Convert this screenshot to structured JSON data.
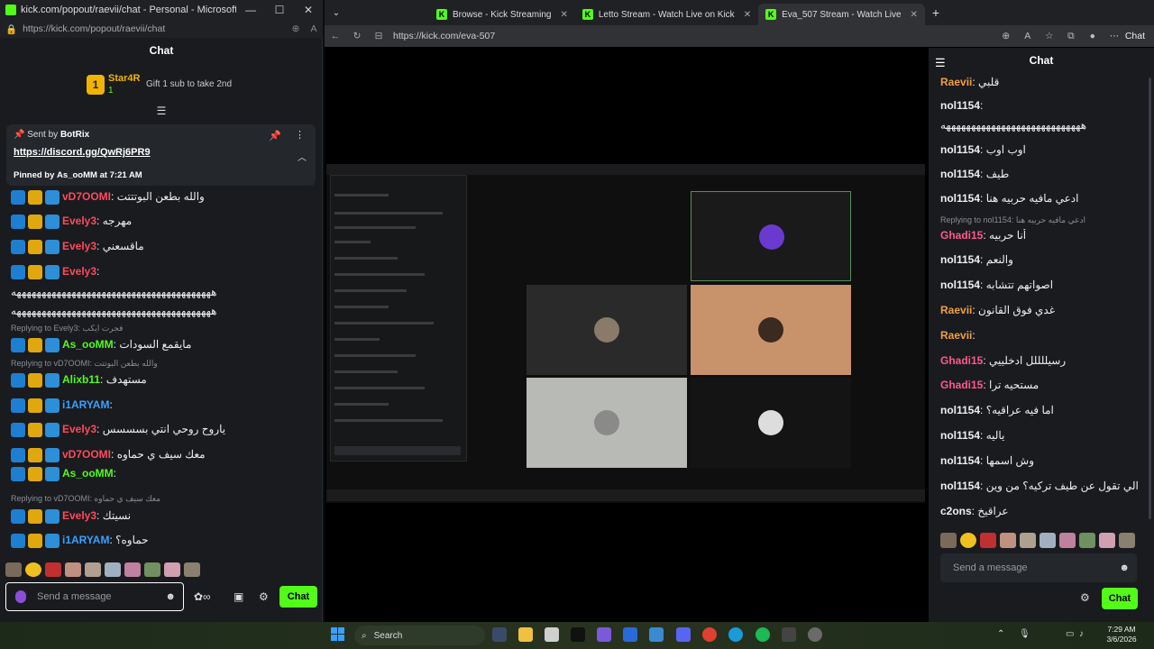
{
  "left_window": {
    "title": "kick.com/popout/raevii/chat - Personal - Microsoft Edge",
    "url": "https://kick.com/popout/raevii/chat",
    "window_controls": {
      "minimize": "—",
      "maximize": "☐",
      "close": "✕"
    },
    "chat_title": "Chat",
    "top_gifter": {
      "rank": "1",
      "name": "Star4R",
      "count": "1",
      "hint": "Gift 1 sub to take 2nd"
    },
    "pinned": {
      "sent_by_label": "Sent by",
      "sent_by_user": "BotRix",
      "link": "https://discord.gg/QwRj6PR9",
      "pinned_by_label": "Pinned by",
      "pinned_by_user": "As_ooMM",
      "pinned_at": "at 7:21 AM"
    },
    "messages": [
      {
        "user": "vD7OOMI",
        "text": ": والله بطعن البوتتتت",
        "color": "#ff4a5c"
      },
      {
        "user": "Evely3",
        "text": ": مهرجه",
        "color": "#ff4a5c"
      },
      {
        "user": "Evely3",
        "text": ": ماقسعني",
        "color": "#ff4a5c"
      },
      {
        "user": "Evely3",
        "text": ":",
        "color": "#ff4a5c"
      },
      {
        "user": "",
        "text": "ههههههههههههههههههههههههههههههههههههههههه",
        "color": "#eee"
      },
      {
        "user": "",
        "text": "ههههههههههههههههههههههههههههههههههههههههه",
        "color": "#eee"
      },
      {
        "reply": "Replying to Evely3: فجرت ايكب"
      },
      {
        "user": "As_ooMM",
        "text": ": مايقمع السودات",
        "color": "#53fc18"
      },
      {
        "reply": "Replying to vD7OOMI: والله بطعن البوتتت"
      },
      {
        "user": "Alixb11",
        "text": ": مستهدف",
        "color": "#53fc18"
      },
      {
        "user": "i1ARYAM",
        "text": ":",
        "color": "#3aa0ff"
      },
      {
        "user": "Evely3",
        "text": ": ياروح روحي انتي بسسسس",
        "color": "#ff4a5c"
      },
      {
        "user": "vD7OOMI",
        "text": ": معك سيف ي حماوه",
        "color": "#ff4a5c"
      },
      {
        "user": "As_ooMM",
        "text": ":",
        "color": "#53fc18"
      },
      {
        "reply": "Replying to vD7OOMI: معك سيف ي حماوه"
      },
      {
        "user": "Evely3",
        "text": ": نسيتك",
        "color": "#ff4a5c"
      },
      {
        "user": "i1ARYAM",
        "text": ": حماوه؟",
        "color": "#3aa0ff"
      }
    ],
    "input_placeholder": "Send a message",
    "chat_button": "Chat"
  },
  "right_window": {
    "tabs": [
      {
        "label": "Browse - Kick Streaming",
        "active": false
      },
      {
        "label": "Letto Stream - Watch Live on Kick",
        "active": false
      },
      {
        "label": "Eva_507 Stream - Watch Live",
        "active": true
      }
    ],
    "url": "https://kick.com/eva-507",
    "copilot_label": "Chat",
    "chat_title": "Chat",
    "messages": [
      {
        "user": "Raevii",
        "text": ": قلبي",
        "color": "#f0a040"
      },
      {
        "user": "nol1154",
        "text": ":",
        "color": "#eee"
      },
      {
        "user": "",
        "text": "ههههههههههههههههههههههههههههه",
        "color": "#eee"
      },
      {
        "user": "nol1154",
        "text": ": اوب اوب",
        "color": "#eee"
      },
      {
        "user": "nol1154",
        "text": ": طيف",
        "color": "#eee"
      },
      {
        "user": "nol1154",
        "text": ": ادعي مافيه حربيه هنا",
        "color": "#eee"
      },
      {
        "reply": "Replying to nol1154: ادعي مافيه حربيه هنا"
      },
      {
        "user": "Ghadi15",
        "text": ": أنا حربيه",
        "color": "#ff5a8a"
      },
      {
        "user": "nol1154",
        "text": ": والنعم",
        "color": "#eee"
      },
      {
        "user": "nol1154",
        "text": ": اصواتهم تتشابه",
        "color": "#eee"
      },
      {
        "user": "Raevii",
        "text": ": غدي فوق القانون",
        "color": "#f0a040"
      },
      {
        "user": "Raevii",
        "text": ":",
        "color": "#f0a040"
      },
      {
        "user": "Ghadi15",
        "text": ": رسيللللل ادخلييي",
        "color": "#ff5a8a"
      },
      {
        "user": "Ghadi15",
        "text": ": مستحيه ترا",
        "color": "#ff5a8a"
      },
      {
        "user": "nol1154",
        "text": ": اما فيه عراقيه؟",
        "color": "#eee"
      },
      {
        "user": "nol1154",
        "text": ": ياليه",
        "color": "#eee"
      },
      {
        "user": "nol1154",
        "text": ": وش اسمها",
        "color": "#eee"
      },
      {
        "user": "nol1154",
        "text": ": الي تقول عن طيف تركيه؟ من وين",
        "color": "#eee"
      },
      {
        "user": "c2ons",
        "text": ": عراقيخ",
        "color": "#eee"
      }
    ],
    "input_placeholder": "Send a message",
    "chat_button": "Chat"
  },
  "taskbar": {
    "search_label": "Search",
    "time": "7:29 AM",
    "date": "3/6/2026"
  },
  "colors": {
    "kick_green": "#53fc18",
    "panel": "#191b1f"
  }
}
